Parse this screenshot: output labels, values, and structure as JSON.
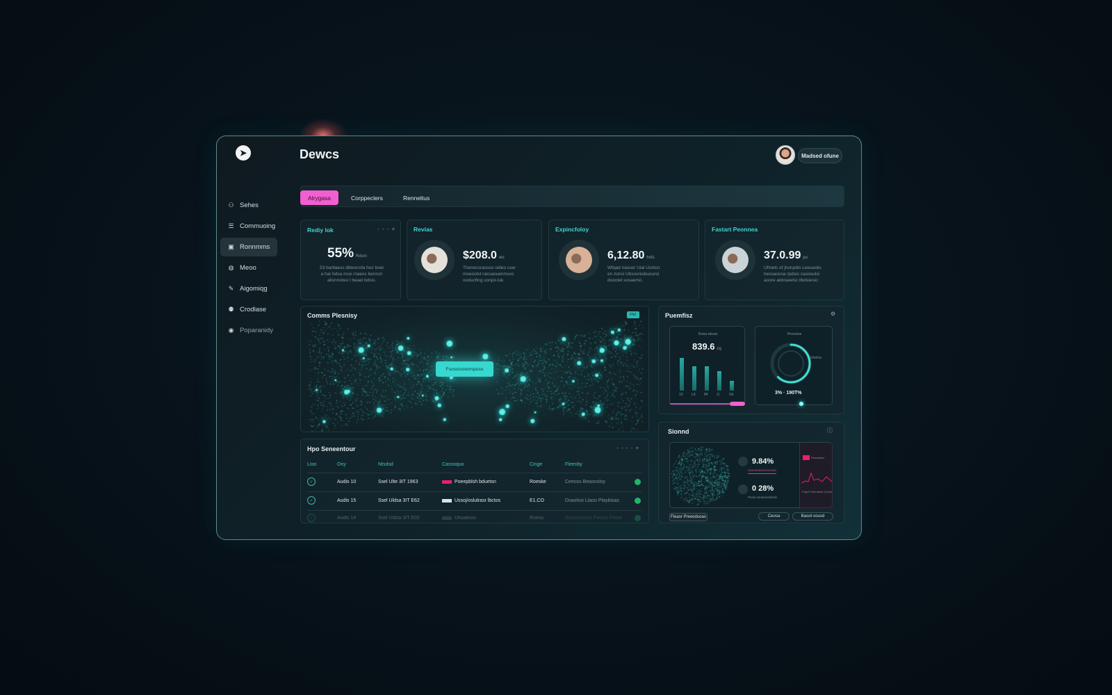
{
  "app": {
    "title": "Dewcs",
    "user_button": "Madsed ofune"
  },
  "sidebar": {
    "items": [
      {
        "label": "Sehes",
        "icon": "people-icon"
      },
      {
        "label": "Commuoing",
        "icon": "list-icon"
      },
      {
        "label": "Ronnmms",
        "icon": "document-icon",
        "active": true
      },
      {
        "label": "Meoo",
        "icon": "circle-icon"
      },
      {
        "label": "Aigomiqg",
        "icon": "pen-icon"
      },
      {
        "label": "Crodlase",
        "icon": "group-icon"
      },
      {
        "label": "Poparanidy",
        "icon": "globe-icon"
      }
    ]
  },
  "tabs": [
    {
      "label": "Alrygasa",
      "active": true
    },
    {
      "label": "Corppeclers"
    },
    {
      "label": "Renneltus"
    }
  ],
  "stats": [
    {
      "title": "Rediy lok",
      "value": "55%",
      "unit": "Rdsm",
      "desc": [
        "53 bartlaess dibeonsfa hez boel",
        "a har bdsa  mce rnaess benscn",
        "allonnoteo t beael bdsis."
      ],
      "menu": "- - - +"
    },
    {
      "title": "Revias",
      "value": "$208.0",
      "unit": "wo",
      "desc": [
        "Thenecsrassoo odleo usw",
        "moeoolst racsaouenrruvo",
        "ooducfing uonpo.luk."
      ]
    },
    {
      "title": "Expincfoloy",
      "value": "6,12.80",
      "unit": "hnfs",
      "desc": [
        "Wfqad nasoor  Uial  Ucdsst",
        "en zonsi  Ubsovnisbuouroi",
        "doootel sosaemo."
      ]
    },
    {
      "title": "Fastart Peonnea",
      "value": "37.0.99",
      "unit": "pu",
      "desc": [
        "Ufmelc of jhonpdis Leesaolis",
        "hessaocoa rpdsio  casooutsi",
        "aoore aldoseelsc.tltelsiesio"
      ]
    }
  ],
  "network": {
    "title": "Comms Plesnisy",
    "badge": "FNZ",
    "center_button": "Fsoso/uooorspuso"
  },
  "table": {
    "title": "Hpo Seneentour",
    "menu": "- - - -  +",
    "headers": [
      "Lioo",
      "Ony",
      "Ntsdsd",
      "Cassoquo",
      "Cinge",
      "Fleenby"
    ],
    "rows": [
      {
        "day": "Audis 10",
        "ntsdsd": "Ssel Ulte 3IT 1963",
        "swatch": "#e8206e",
        "cassoquo": "Poeepblsh bduetsn",
        "cinge": "Roeske",
        "fleenby": "Ceeoss Beasnolsy"
      },
      {
        "day": "Audis 15",
        "ntsdsd": "Ssel Uldsa 3IT E62",
        "swatch": "#cfe6ee",
        "cassoquo": "Ussoj/oslulrasr lbctos",
        "cinge": "E1.CO",
        "fleenby": "Dsaolsoi Llaoo Playbisas"
      },
      {
        "day": "Aodls 14",
        "ntsdsd": "Ssel Uldsa 3IT E02",
        "swatch": "#6a7a80",
        "cassoquo": "Ulsoalsoo",
        "cinge": "Roeso",
        "fleenby": "Roeoaclolsa Peoolo Foool"
      }
    ]
  },
  "performance": {
    "title": "Puemfisz",
    "bar_card": {
      "label": "Dowu.ebsao",
      "value": "839.6",
      "unit": "cq",
      "bars": [
        47,
        35,
        35,
        28,
        14
      ],
      "bar_labels": [
        "19",
        "LK",
        "84",
        "1I",
        "Gk"
      ],
      "slider": 0.88
    },
    "ring_card": {
      "label": "Penoeise",
      "legend": "Ueeioa",
      "progress": 0.62,
      "readout": "3% · 190T%"
    }
  },
  "stand": {
    "title": "Sionnd",
    "metrics": [
      {
        "value": "9.84%",
        "label": "ueseotsasoessosoia"
      },
      {
        "value": "0 28%",
        "label": "Pesis oeoasoonlosiis"
      }
    ],
    "spark_caption": "Fdpol Peeentbsa Ceeoli",
    "spark_title": "Plosoadsd",
    "buttons": [
      "Fleasr Preeoduoas",
      "Ceosa",
      "Baoot oousd"
    ]
  },
  "colors": {
    "accent": "#3fd6cf",
    "pink": "#f25fd0",
    "bg": "#07121a"
  }
}
